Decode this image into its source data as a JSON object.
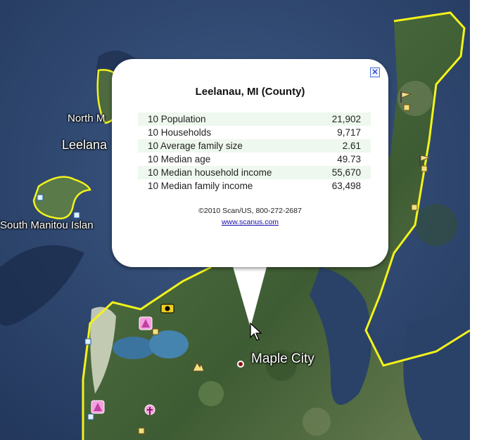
{
  "map_labels": {
    "north_manitou": "North M",
    "leelanau": "Leelana",
    "south_manitou": "South Manitou Islan",
    "maple_city": "Maple City"
  },
  "popup": {
    "title": "Leelanau, MI (County)",
    "close_symbol": "✕",
    "rows": [
      {
        "label": "10 Population",
        "value": "21,902"
      },
      {
        "label": "10 Households",
        "value": "9,717"
      },
      {
        "label": "10 Average family size",
        "value": "2.61"
      },
      {
        "label": "10 Median age",
        "value": "49.73"
      },
      {
        "label": "10 Median household income",
        "value": "55,670"
      },
      {
        "label": "10 Median family income",
        "value": "63,498"
      }
    ],
    "copyright": "©2010 Scan/US, 800-272-2687",
    "link": "www.scanus.com"
  },
  "icons": [
    "park-marker-icon",
    "camera-icon",
    "hiker-icon",
    "flag-icon",
    "picnic-icon",
    "info-marker-icon",
    "place-dot-icon",
    "mouse-cursor-icon"
  ],
  "colors": {
    "boundary": "#f3f31a",
    "water": "#2e4670",
    "land": "#4a6a3a",
    "sand": "#d9dcc8"
  }
}
